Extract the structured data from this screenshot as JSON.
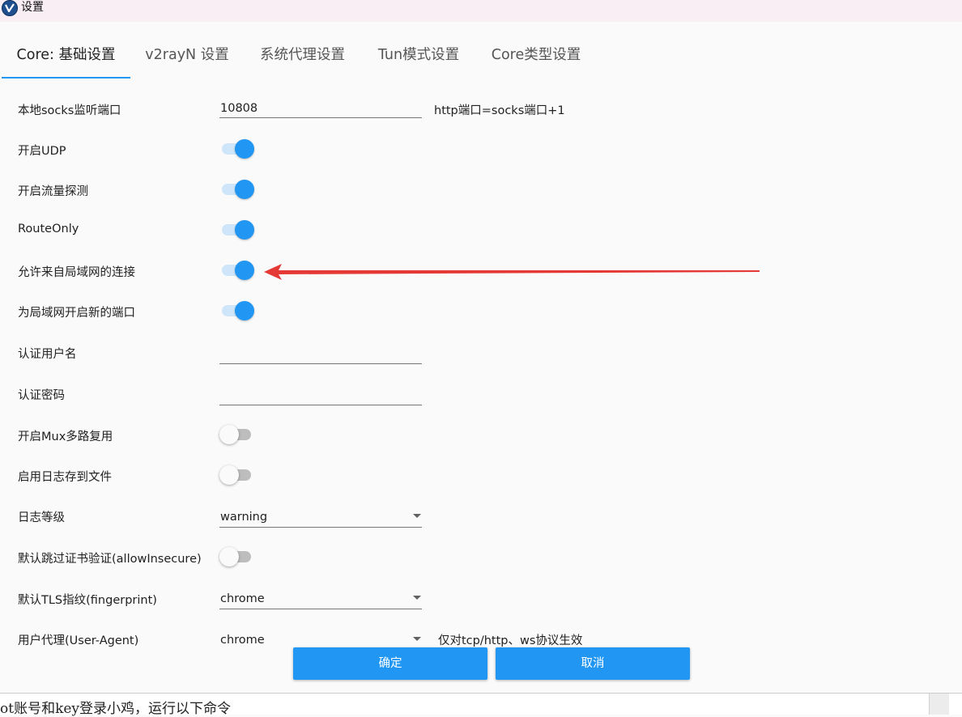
{
  "window": {
    "title": "设置",
    "icon": "v2rayn-logo-icon"
  },
  "tabs": [
    {
      "label": "Core: 基础设置",
      "active": true
    },
    {
      "label": "v2rayN 设置",
      "active": false
    },
    {
      "label": "系统代理设置",
      "active": false
    },
    {
      "label": "Tun模式设置",
      "active": false
    },
    {
      "label": "Core类型设置",
      "active": false
    }
  ],
  "settings": {
    "socks_port": {
      "label": "本地socks监听端口",
      "value": "10808",
      "hint": "http端口=socks端口+1"
    },
    "udp": {
      "label": "开启UDP",
      "on": true
    },
    "sniffing": {
      "label": "开启流量探测",
      "on": true
    },
    "route_only": {
      "label": "RouteOnly",
      "on": true
    },
    "allow_lan": {
      "label": "允许来自局域网的连接",
      "on": true
    },
    "lan_new_port": {
      "label": "为局域网开启新的端口",
      "on": true
    },
    "auth_user": {
      "label": "认证用户名",
      "value": ""
    },
    "auth_pass": {
      "label": "认证密码",
      "value": ""
    },
    "mux": {
      "label": "开启Mux多路复用",
      "on": false
    },
    "log_to_file": {
      "label": "启用日志存到文件",
      "on": false
    },
    "log_level": {
      "label": "日志等级",
      "value": "warning"
    },
    "allow_insecure": {
      "label": "默认跳过证书验证(allowInsecure)",
      "on": false
    },
    "fingerprint": {
      "label": "默认TLS指纹(fingerprint)",
      "value": "chrome"
    },
    "user_agent": {
      "label": "用户代理(User-Agent)",
      "value": "chrome",
      "hint": "仅对tcp/http、ws协议生效"
    }
  },
  "buttons": {
    "ok": "确定",
    "cancel": "取消"
  },
  "background_window": {
    "text": "ot账号和key登录小鸡，运行以下命令"
  },
  "annotation": {
    "arrow_color": "#e53935"
  },
  "colors": {
    "accent": "#2196f3",
    "toggle_track_on": "#cfe6fa",
    "toggle_off": "#bdbdbd"
  }
}
